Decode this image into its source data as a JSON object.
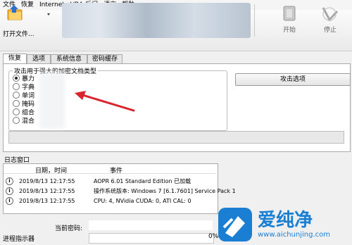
{
  "menu": [
    "文件",
    "恢复",
    "Internet",
    "VBA 后门",
    "语言",
    "帮助"
  ],
  "toolbar": {
    "open_label": "打开文件...",
    "start_label": "开始",
    "stop_label": "停止"
  },
  "tabs": [
    "恢复",
    "选项",
    "系统信息",
    "密码缓存"
  ],
  "attack_group": {
    "title": "攻击用于强大的加密文档类型",
    "options": [
      "暴力",
      "字典",
      "单词",
      "掩码",
      "组合",
      "混合"
    ],
    "selected_index": 0
  },
  "attack_options_button": "攻击选项",
  "log": {
    "title": "日志窗口",
    "columns": [
      "日期，时间",
      "事件"
    ],
    "rows": [
      {
        "date": "2019/8/13 12:17:55",
        "event": "AOPR 6.01 Standard Edition 已加载"
      },
      {
        "date": "2019/8/13 12:17:55",
        "event": "操作系统版本: Windows 7 [6.1.7601] Service Pack 1"
      },
      {
        "date": "2019/8/13 12:17:55",
        "event": "CPU: 4, NVidia CUDA: 0, ATI CAL: 0"
      }
    ]
  },
  "current_password_label": "当前密码:",
  "progress_label": "进程指示器",
  "progress_value": "0%",
  "watermark": {
    "brand": "爱纯净",
    "url": "www.aichunjing.com"
  },
  "colors": {
    "arrow": "#d9232d",
    "watermark_blue": "#1a7fd3"
  }
}
